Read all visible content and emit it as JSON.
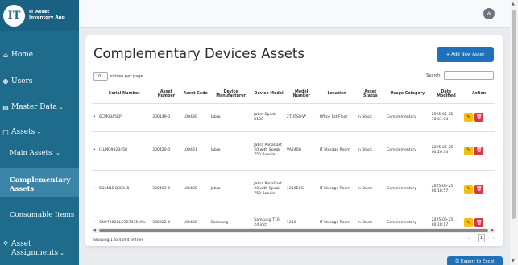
{
  "app": {
    "name_line1": "IT Asset",
    "name_line2": "Inventory App",
    "logo_text": "IT"
  },
  "sidebar": {
    "home": "Home",
    "users": "Users",
    "master_data": "Master Data",
    "assets": "Assets",
    "main_assets": "Main Assets",
    "complementary_line1": "Complementary",
    "complementary_line2": "Assets",
    "consumable_items": "Consumable Items",
    "asset_assignments_line1": "Asset",
    "asset_assignments_line2": "Assignments"
  },
  "topbar": {
    "avatar": "W"
  },
  "page": {
    "title": "Complementary Devices Assets",
    "add_button": "+ Add New Asset",
    "entries_value": "10",
    "entries_label": "entries per page",
    "search_label": "Search:"
  },
  "table": {
    "columns": [
      "Serial Number",
      "Asset Number",
      "Asset Code",
      "Device Manufacturer",
      "Device Model",
      "Model Number",
      "Location",
      "Asset Status",
      "Usage Category",
      "Date Modified",
      "Action"
    ],
    "rows": [
      {
        "serial": "6CM0345KP",
        "asset_number": "300149-0",
        "asset_code": "L00480",
        "manufacturer": "Jabra",
        "model": "Jabra Speak 8100",
        "model_number": "2TU5S0-W",
        "location": "Office 1st Floor",
        "status": "In Stock",
        "usage": "Complementary",
        "date": "2025-06-25 10:41:04"
      },
      {
        "serial": "J3LMQ9023458",
        "asset_number": "300420-0",
        "asset_code": "L00491",
        "manufacturer": "Jabra",
        "model": "Jabra PanaCast 20 with Speak 750 Bundle",
        "model_number": "VA240G",
        "location": "IT Storage Room",
        "status": "In Stock",
        "usage": "Complementary",
        "date": "2025-06-25 00:20:34"
      },
      {
        "serial": "5D4N1DQ38345",
        "asset_number": "300403-0",
        "asset_code": "L00489",
        "manufacturer": "Jabra",
        "model": "Jabra PanaCast 20 with Speak 750 Bundle",
        "model_number": "1210E8G",
        "location": "IT Storage Room",
        "status": "In Stock",
        "usage": "Complementary",
        "date": "2025-06-25 00:18:57"
      },
      {
        "serial": "CN073K2BLG7274351ML",
        "asset_number": "300322-0",
        "asset_code": "L00430",
        "manufacturer": "Samsung",
        "model": "Samsung T10 24 inch",
        "model_number": "1210",
        "location": "IT Storage Room",
        "status": "In Stock",
        "usage": "Complementary",
        "date": "2025-06-25 00:18:17"
      }
    ]
  },
  "footer": {
    "info": "Showing 1 to 4 of 4 entries",
    "page_first": "«",
    "page_prev": "‹",
    "page_current": "1",
    "page_next": "›",
    "page_last": "»",
    "export_button": "Export to Excel"
  },
  "icons": {
    "home": "home-icon",
    "users": "users-icon",
    "master_data": "database-icon",
    "assets": "assets-icon",
    "assignments": "assignments-icon",
    "edit": "pencil-icon",
    "delete": "trash-icon",
    "export": "print-icon"
  },
  "colors": {
    "sidebar": "#1e6b8c",
    "primary": "#1f72b9",
    "edit": "#f4c20d",
    "delete": "#dc3545"
  }
}
